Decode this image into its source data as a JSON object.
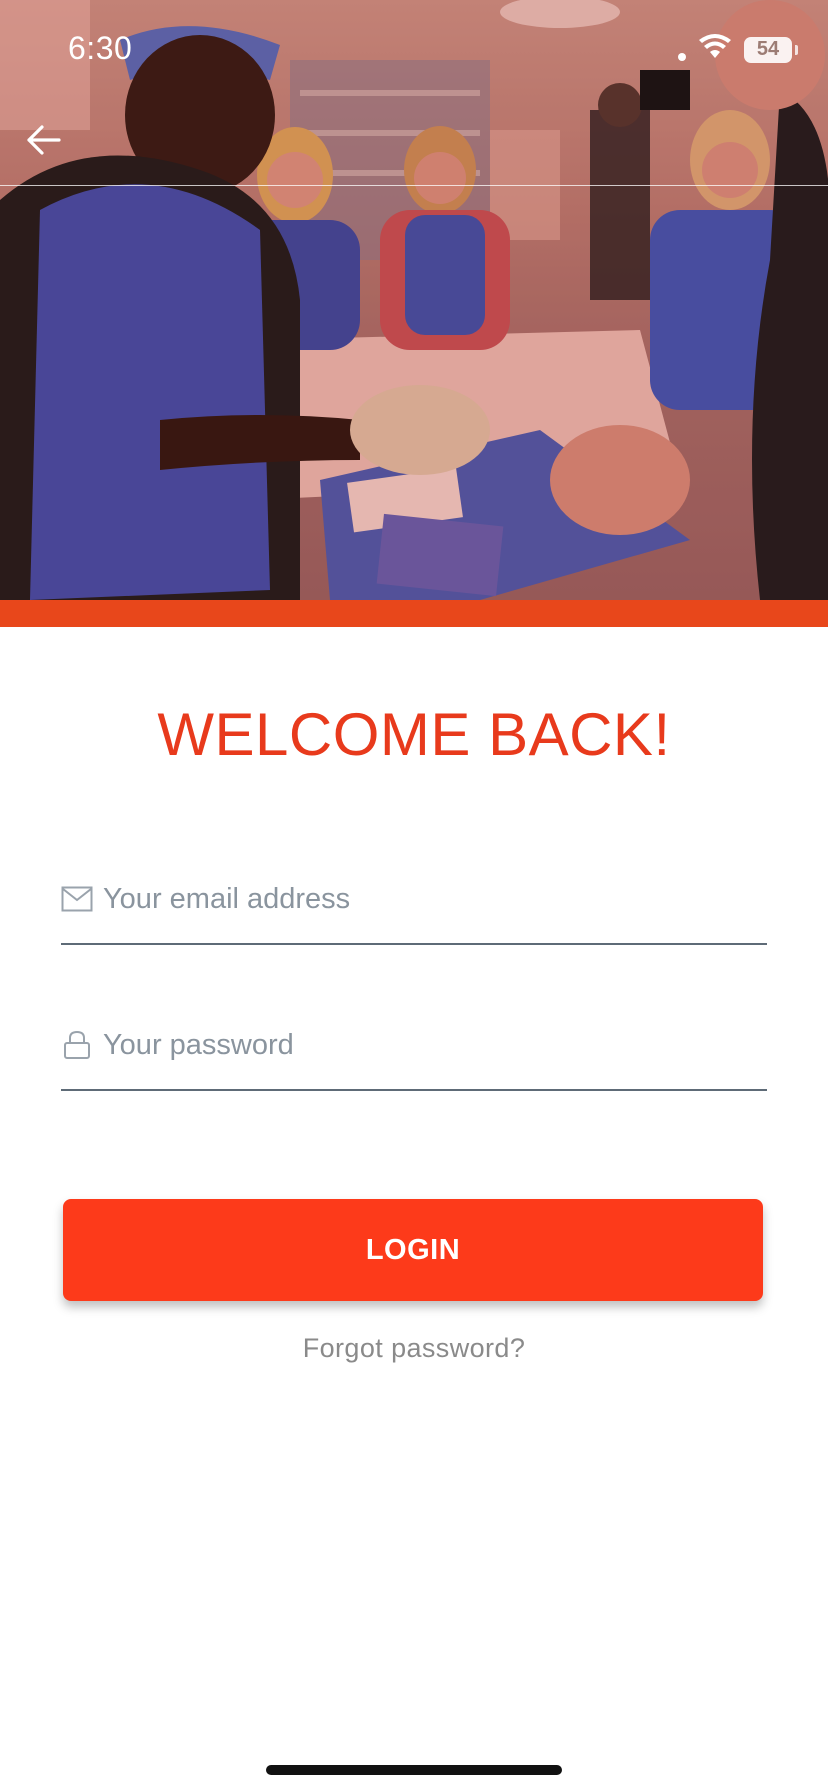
{
  "status_bar": {
    "time": "6:30",
    "battery": "54",
    "icons": [
      "signal-dot-icon",
      "wifi-icon",
      "battery-icon"
    ]
  },
  "header": {
    "back_icon": "arrow-left-icon",
    "hero_image": "medical-procedure-photo"
  },
  "login": {
    "title": "WELCOME BACK!",
    "email": {
      "placeholder": "Your email address",
      "value": "",
      "icon": "envelope-icon"
    },
    "password": {
      "placeholder": "Your password",
      "value": "",
      "icon": "lock-icon"
    },
    "login_label": "LOGIN",
    "forgot_label": "Forgot password?"
  },
  "colors": {
    "accent": "#fd3a1a",
    "title": "#e83a1c",
    "band": "#e8471b",
    "field_line": "#5e6b77",
    "placeholder": "#8a949e"
  }
}
